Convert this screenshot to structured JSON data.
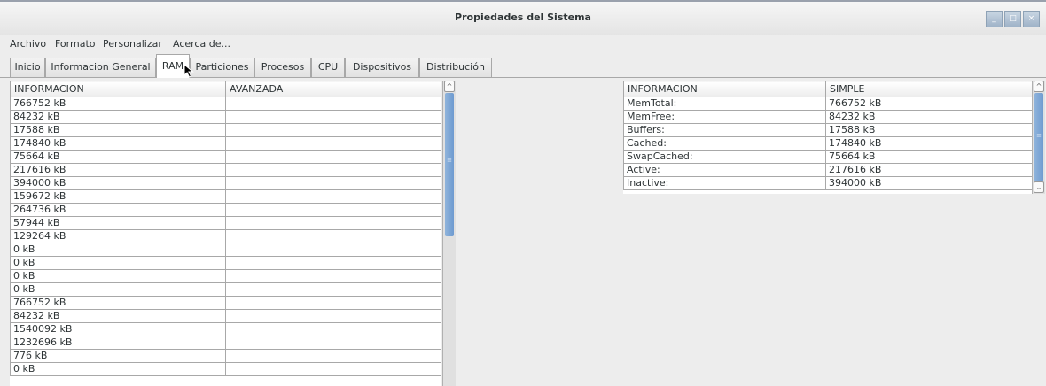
{
  "window": {
    "title": "Propiedades del Sistema",
    "buttons": {
      "minimize": "_",
      "maximize": "□",
      "close": "×"
    }
  },
  "menu": [
    "Archivo",
    "Formato",
    "Personalizar",
    "Acerca de..."
  ],
  "tabs": [
    "Inicio",
    "Informacion General",
    "RAM",
    "Particiones",
    "Procesos",
    "CPU",
    "Dispositivos",
    "Distribución"
  ],
  "active_tab": "RAM",
  "left_table": {
    "headers": [
      "INFORMACION",
      "AVANZADA"
    ],
    "rows": [
      [
        "766752 kB",
        ""
      ],
      [
        "84232 kB",
        ""
      ],
      [
        "17588 kB",
        ""
      ],
      [
        "174840 kB",
        ""
      ],
      [
        "75664 kB",
        ""
      ],
      [
        "217616 kB",
        ""
      ],
      [
        "394000 kB",
        ""
      ],
      [
        "159672 kB",
        ""
      ],
      [
        "264736 kB",
        ""
      ],
      [
        "57944 kB",
        ""
      ],
      [
        "129264 kB",
        ""
      ],
      [
        "0 kB",
        ""
      ],
      [
        "0 kB",
        ""
      ],
      [
        "0 kB",
        ""
      ],
      [
        "0 kB",
        ""
      ],
      [
        "766752 kB",
        ""
      ],
      [
        "84232 kB",
        ""
      ],
      [
        "1540092 kB",
        ""
      ],
      [
        "1232696 kB",
        ""
      ],
      [
        "776 kB",
        ""
      ],
      [
        "0 kB",
        ""
      ]
    ]
  },
  "right_table": {
    "headers": [
      "INFORMACION",
      "SIMPLE"
    ],
    "rows": [
      [
        "MemTotal:",
        "766752 kB"
      ],
      [
        "MemFree:",
        "84232 kB"
      ],
      [
        "Buffers:",
        "17588 kB"
      ],
      [
        "Cached:",
        "174840 kB"
      ],
      [
        "SwapCached:",
        "75664 kB"
      ],
      [
        "Active:",
        "217616 kB"
      ],
      [
        "Inactive:",
        "394000 kB"
      ]
    ]
  },
  "scrollbar_arrows": {
    "up": "^",
    "down": "⌄",
    "grip": "≡"
  }
}
